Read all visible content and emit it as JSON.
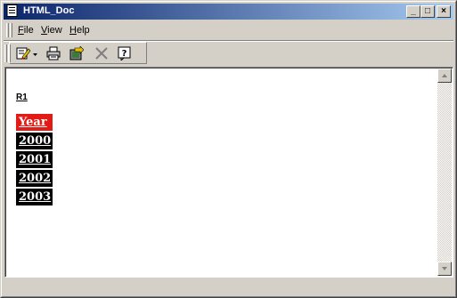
{
  "window": {
    "title": "HTML_Doc"
  },
  "title_buttons": {
    "minimize": "_",
    "maximize": "□",
    "close": "×"
  },
  "menu": [
    {
      "label_first": "F",
      "label_rest": "ile"
    },
    {
      "label_first": "V",
      "label_rest": "iew"
    },
    {
      "label_first": "H",
      "label_rest": "elp"
    }
  ],
  "toolbar": {
    "icons": [
      "edit-dropdown-icon",
      "print-icon",
      "export-icon",
      "delete-icon",
      "help-icon"
    ]
  },
  "document": {
    "heading": "R1",
    "table": {
      "header": "Year",
      "rows": [
        "2000",
        "2001",
        "2002",
        "2003"
      ]
    }
  },
  "colors": {
    "titlebar_start": "#0a246a",
    "titlebar_end": "#a6caf0",
    "header_cell": "#e31b17",
    "data_cell": "#000000"
  }
}
